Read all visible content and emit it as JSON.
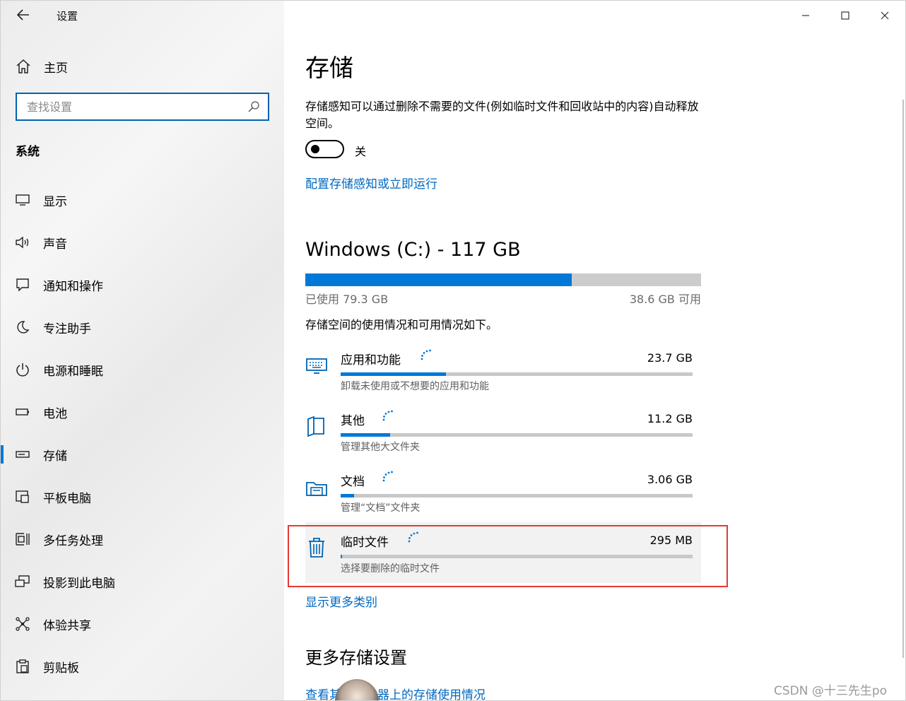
{
  "window": {
    "title": "设置",
    "controls": {
      "minimize": "minimize-icon",
      "maximize": "maximize-icon",
      "close": "close-icon"
    }
  },
  "sidebar": {
    "home_label": "主页",
    "search_placeholder": "查找设置",
    "section_label": "系统",
    "items": [
      {
        "label": "显示",
        "icon": "display-icon"
      },
      {
        "label": "声音",
        "icon": "speaker-icon"
      },
      {
        "label": "通知和操作",
        "icon": "notification-icon"
      },
      {
        "label": "专注助手",
        "icon": "moon-icon"
      },
      {
        "label": "电源和睡眠",
        "icon": "power-icon"
      },
      {
        "label": "电池",
        "icon": "battery-icon"
      },
      {
        "label": "存储",
        "icon": "storage-icon",
        "active": true
      },
      {
        "label": "平板电脑",
        "icon": "tablet-icon"
      },
      {
        "label": "多任务处理",
        "icon": "multitask-icon"
      },
      {
        "label": "投影到此电脑",
        "icon": "project-icon"
      },
      {
        "label": "体验共享",
        "icon": "share-icon"
      },
      {
        "label": "剪贴板",
        "icon": "clipboard-icon"
      }
    ]
  },
  "main": {
    "title": "存储",
    "storage_sense_desc": "存储感知可以通过删除不需要的文件(例如临时文件和回收站中的内容)自动释放空间。",
    "toggle_state": "关",
    "configure_link": "配置存储感知或立即运行",
    "drive": {
      "title": "Windows (C:) - 117 GB",
      "used_label": "已使用 79.3 GB",
      "free_label": "38.6 GB 可用",
      "used_fraction": 0.673
    },
    "usage_desc": "存储空间的使用情况和可用情况如下。",
    "categories": [
      {
        "name": "应用和功能",
        "size": "23.7 GB",
        "sub": "卸载未使用或不想要的应用和功能",
        "fraction": 0.3,
        "icon": "keyboard-icon"
      },
      {
        "name": "其他",
        "size": "11.2 GB",
        "sub": "管理其他大文件夹",
        "fraction": 0.14,
        "icon": "document-folder-icon"
      },
      {
        "name": "文档",
        "size": "3.06 GB",
        "sub": "管理“文档”文件夹",
        "fraction": 0.038,
        "icon": "documents-icon"
      },
      {
        "name": "临时文件",
        "size": "295 MB",
        "sub": "选择要删除的临时文件",
        "fraction": 0.004,
        "icon": "trash-icon",
        "highlight": true
      }
    ],
    "show_more_link": "显示更多类别",
    "more_settings_title": "更多存储设置",
    "other_drives_link": "查看其他驱动器上的存储使用情况"
  },
  "watermark": "CSDN @十三先生po",
  "colors": {
    "accent": "#0078d7",
    "link": "#0067c0",
    "highlight_border": "#e53935"
  }
}
